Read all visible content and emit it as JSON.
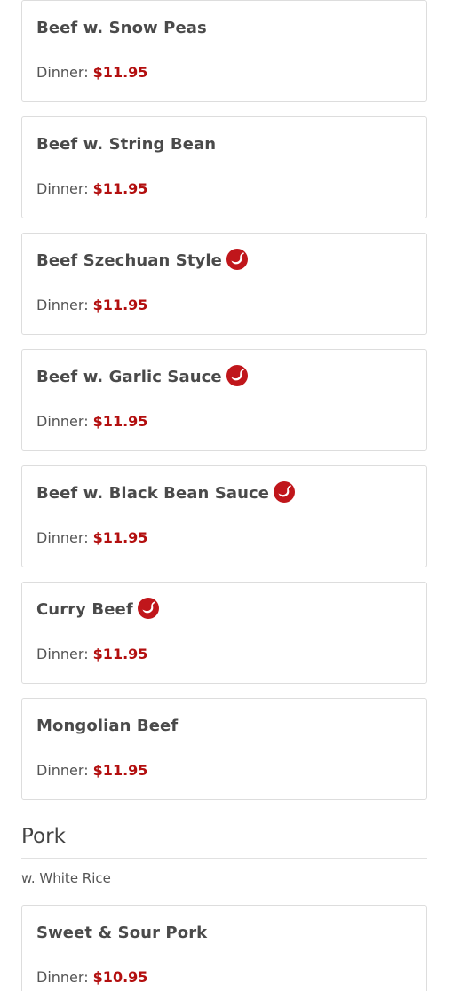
{
  "beef_items": [
    {
      "name": "Beef w. Snow Peas",
      "spicy": false,
      "price_label": "Dinner:",
      "price": "$11.95"
    },
    {
      "name": "Beef w. String Bean",
      "spicy": false,
      "price_label": "Dinner:",
      "price": "$11.95"
    },
    {
      "name": "Beef Szechuan Style",
      "spicy": true,
      "price_label": "Dinner:",
      "price": "$11.95"
    },
    {
      "name": "Beef w. Garlic Sauce",
      "spicy": true,
      "price_label": "Dinner:",
      "price": "$11.95"
    },
    {
      "name": "Beef w. Black Bean Sauce",
      "spicy": true,
      "price_label": "Dinner:",
      "price": "$11.95"
    },
    {
      "name": "Curry Beef",
      "spicy": true,
      "price_label": "Dinner:",
      "price": "$11.95"
    },
    {
      "name": "Mongolian Beef",
      "spicy": false,
      "price_label": "Dinner:",
      "price": "$11.95"
    }
  ],
  "pork_section": {
    "title": "Pork",
    "subtitle": "w. White Rice",
    "items": [
      {
        "name": "Sweet & Sour Pork",
        "spicy": false,
        "price_label": "Dinner:",
        "price": "$10.95"
      }
    ]
  },
  "icons": {
    "spicy": "chili-pepper-icon"
  },
  "colors": {
    "price": "#b30f0f",
    "spicy_badge": "#c0161b",
    "card_border": "#dddddd",
    "text": "#4a4a4a"
  }
}
